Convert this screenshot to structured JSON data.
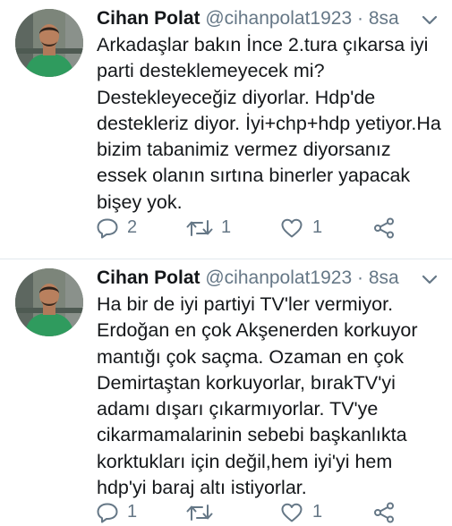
{
  "colors": {
    "name": "#14171a",
    "secondary": "#657786",
    "divider": "#e1e8ed",
    "avatar_shirt": "#2f9b5e"
  },
  "tweets": [
    {
      "author": {
        "name": "Cihan Polat",
        "handle": "@cihanpolat1923",
        "avatar_icon": "user-avatar-photo"
      },
      "separator": "·",
      "time": "8sa",
      "text": "Arkadaşlar bakın İnce 2.tura çıkarsa iyi\nparti desteklemeyecek mi?\nDestekleyeceğiz diyorlar. Hdp'de\ndestekleriz diyor. İyi+chp+hdp yetiyor.Ha\nbizim tabanimiz vermez diyorsanız\nessek olanın sırtına binerler yapacak\nbişey yok.",
      "actions": {
        "replies": "2",
        "retweets": "1",
        "likes": "1"
      }
    },
    {
      "author": {
        "name": "Cihan Polat",
        "handle": "@cihanpolat1923",
        "avatar_icon": "user-avatar-photo"
      },
      "separator": "·",
      "time": "8sa",
      "text": "Ha bir de iyi partiyi TV'ler vermiyor.\nErdoğan en çok Akşenerden korkuyor\nmantığı çok saçma. Ozaman en çok\nDemirtaştan korkuyorlar, bırakTV'yi\nadamı dışarı çıkarmıyorlar. TV'ye\ncikarmamalarinin sebebi başkanlıkta\nkorktukları için değil,hem iyi'yi hem\nhdp'yi baraj altı istiyorlar.",
      "actions": {
        "replies": "1",
        "retweets": "",
        "likes": "1"
      }
    }
  ]
}
